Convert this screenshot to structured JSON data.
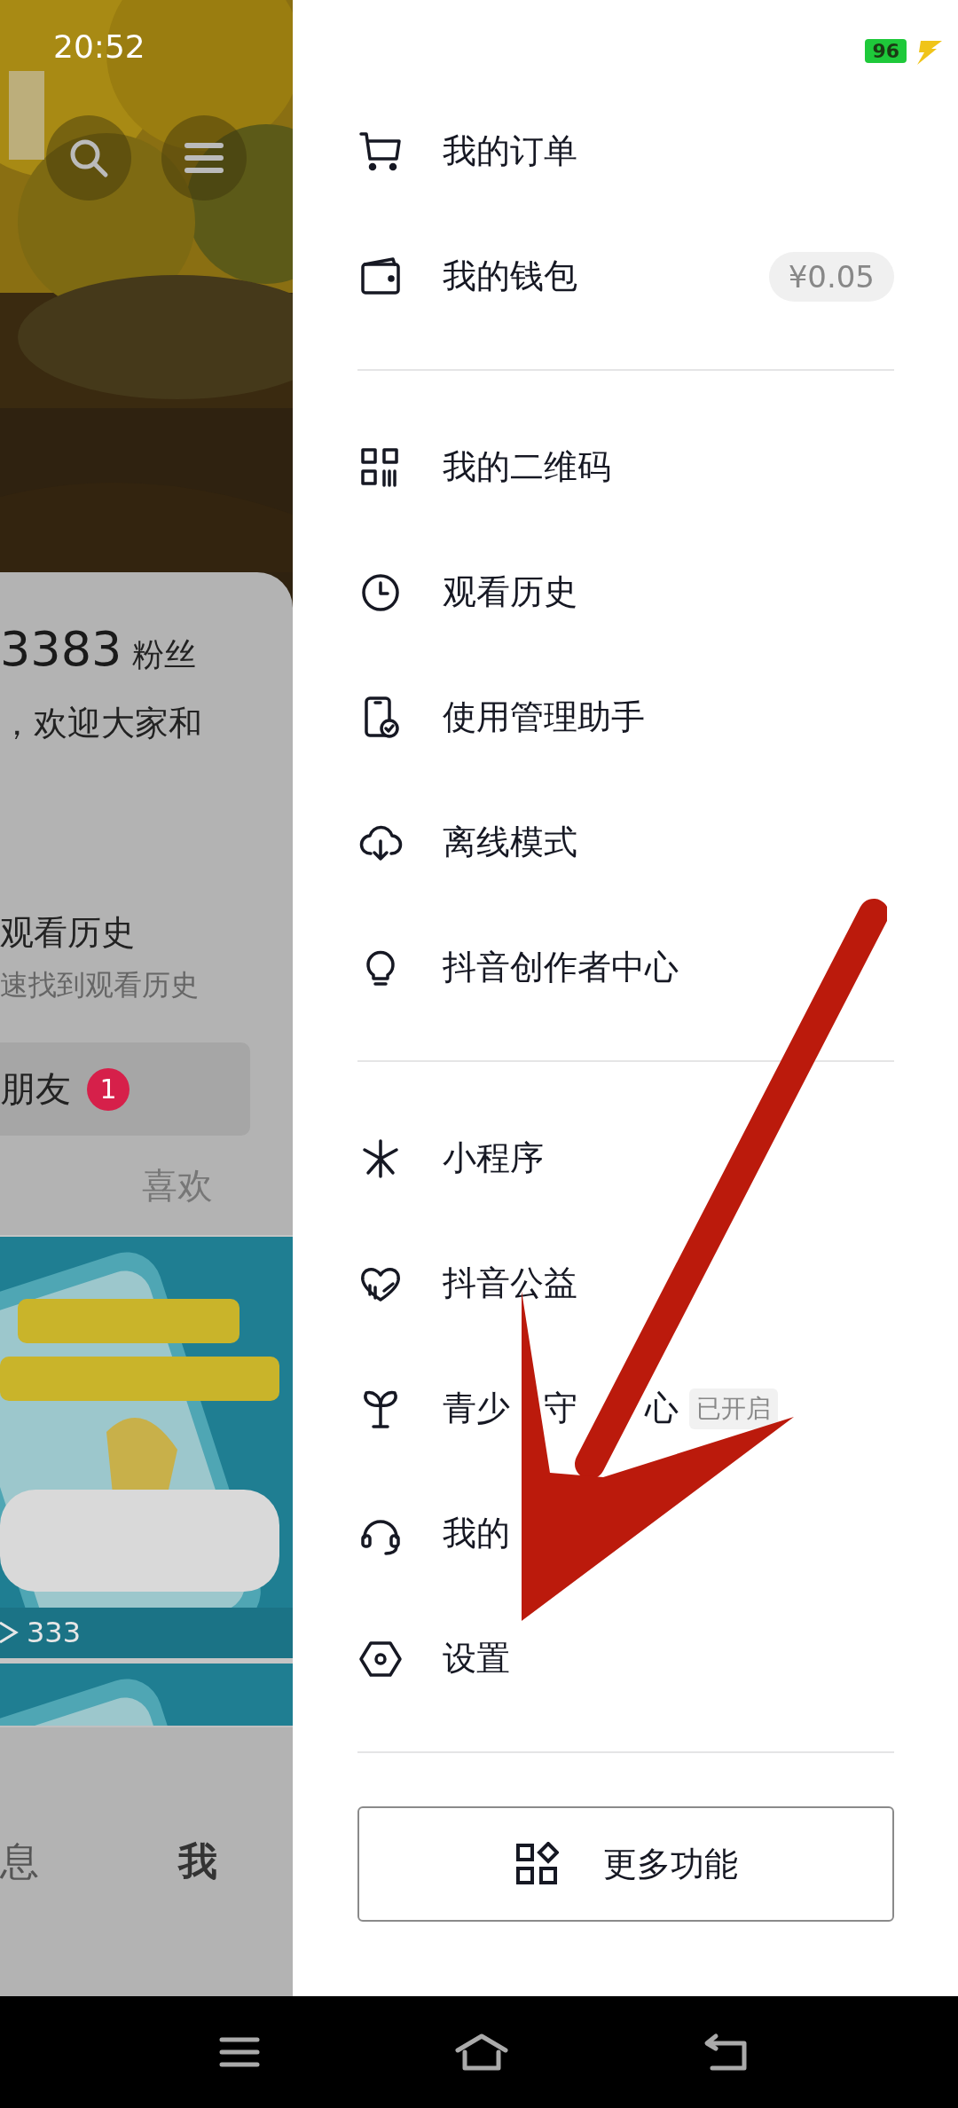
{
  "status_bar": {
    "time": "20:52",
    "battery": "96"
  },
  "profile": {
    "followers_count": "3383",
    "followers_label": "粉丝",
    "bio": "，欢迎大家和",
    "history_card": {
      "title": "观看历史",
      "subtitle": "速找到观看历史"
    },
    "friends_chip": {
      "label": "朋友",
      "badge": "1"
    },
    "tabs": [
      {
        "label": "喜欢",
        "selected": false
      }
    ],
    "videos": [
      {
        "kind": "picture",
        "views": "333"
      },
      {
        "kind": "picture"
      }
    ],
    "bottom_nav": [
      {
        "label": "息",
        "selected": false
      },
      {
        "label": "我",
        "selected": true
      }
    ]
  },
  "drawer": {
    "sections": [
      {
        "items": [
          {
            "label": "我的订单"
          },
          {
            "label": "我的钱包",
            "value": "¥0.05"
          }
        ]
      },
      {
        "items": [
          {
            "label": "我的二维码"
          },
          {
            "label": "观看历史"
          },
          {
            "label": "使用管理助手"
          },
          {
            "label": "离线模式"
          },
          {
            "label": "抖音创作者中心"
          }
        ]
      },
      {
        "items": [
          {
            "label": "小程序"
          },
          {
            "label": "抖音公益"
          },
          {
            "label_parts": [
              "青少",
              "守",
              "心"
            ],
            "tag": "已开启"
          },
          {
            "label_parts": [
              "我的"
            ]
          },
          {
            "label": "设置"
          }
        ]
      }
    ],
    "more_button": "更多功能"
  }
}
